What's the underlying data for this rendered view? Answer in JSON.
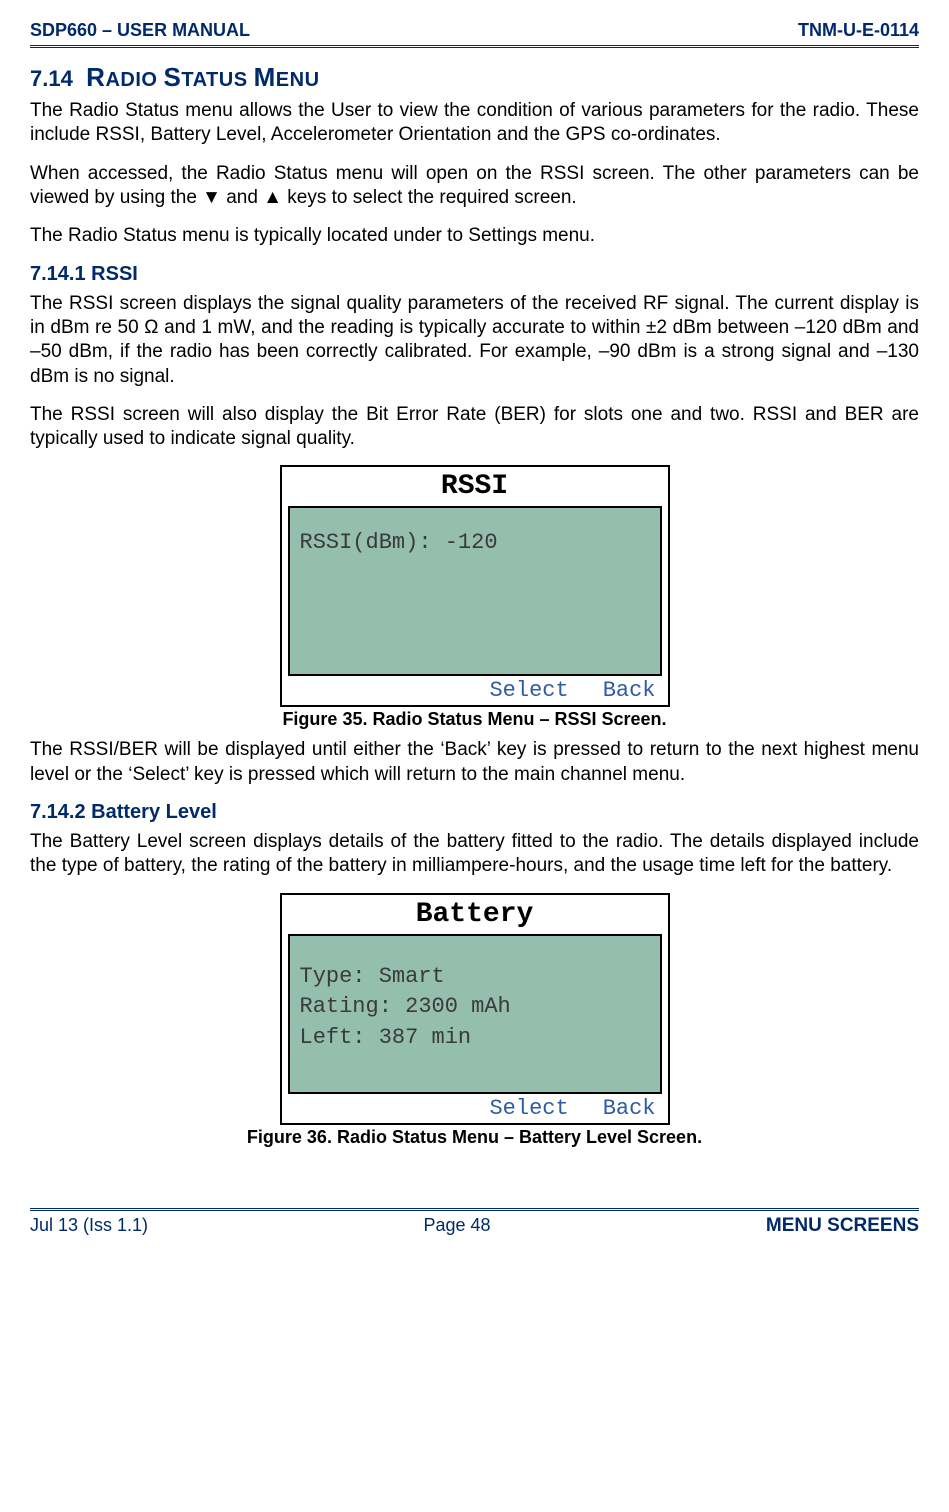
{
  "header": {
    "left": "SDP660 – USER MANUAL",
    "right": "TNM-U-E-0114"
  },
  "section": {
    "number": "7.14",
    "title_caps_1": "R",
    "title_rest_1": "ADIO ",
    "title_caps_2": "S",
    "title_rest_2": "TATUS ",
    "title_caps_3": "M",
    "title_rest_3": "ENU",
    "p1": "The Radio Status menu allows the User to view the condition of various parameters for the radio. These include RSSI, Battery Level, Accelerometer Orientation and the GPS co-ordinates.",
    "p2": "When accessed, the Radio Status menu will open on the RSSI screen.  The other parameters can be viewed by using the ▼ and ▲ keys to select the required screen.",
    "p3": "The Radio Status menu is typically located under to Settings menu."
  },
  "sub1": {
    "heading": "7.14.1   RSSI",
    "p1": "The RSSI screen displays the signal quality parameters of the received RF signal.  The current display is in dBm re 50 Ω and 1 mW, and the reading is typically accurate to within ±2 dBm between –120 dBm and –50 dBm, if the radio has been correctly calibrated.  For example, –90 dBm is a strong signal and –130 dBm is no signal.",
    "p2": "The RSSI screen will also display the Bit Error Rate (BER) for slots one and two.  RSSI and BER are typically used to indicate signal quality.",
    "lcd": {
      "title": "RSSI",
      "line1": "RSSI(dBm): -120",
      "select": "Select",
      "back": "Back"
    },
    "fig": "Figure 35.  Radio Status Menu – RSSI Screen.",
    "p3": "The RSSI/BER will be displayed until either the ‘Back’ key is pressed to return to the next highest menu level or the ‘Select’ key is pressed which will return to the main channel menu."
  },
  "sub2": {
    "heading": "7.14.2   Battery Level",
    "p1": "The Battery Level screen displays details of the battery fitted to the radio.  The details displayed include the type of battery, the rating of the battery in milliampere-hours, and the usage time left for the battery.",
    "lcd": {
      "title": "Battery",
      "line1": "Type: Smart",
      "line2": "Rating: 2300 mAh",
      "line3": "Left: 387 min",
      "select": "Select",
      "back": "Back"
    },
    "fig": "Figure 36.  Radio Status Menu – Battery Level Screen."
  },
  "footer": {
    "left": "Jul 13 (Iss 1.1)",
    "center": "Page 48",
    "right": "MENU SCREENS"
  }
}
